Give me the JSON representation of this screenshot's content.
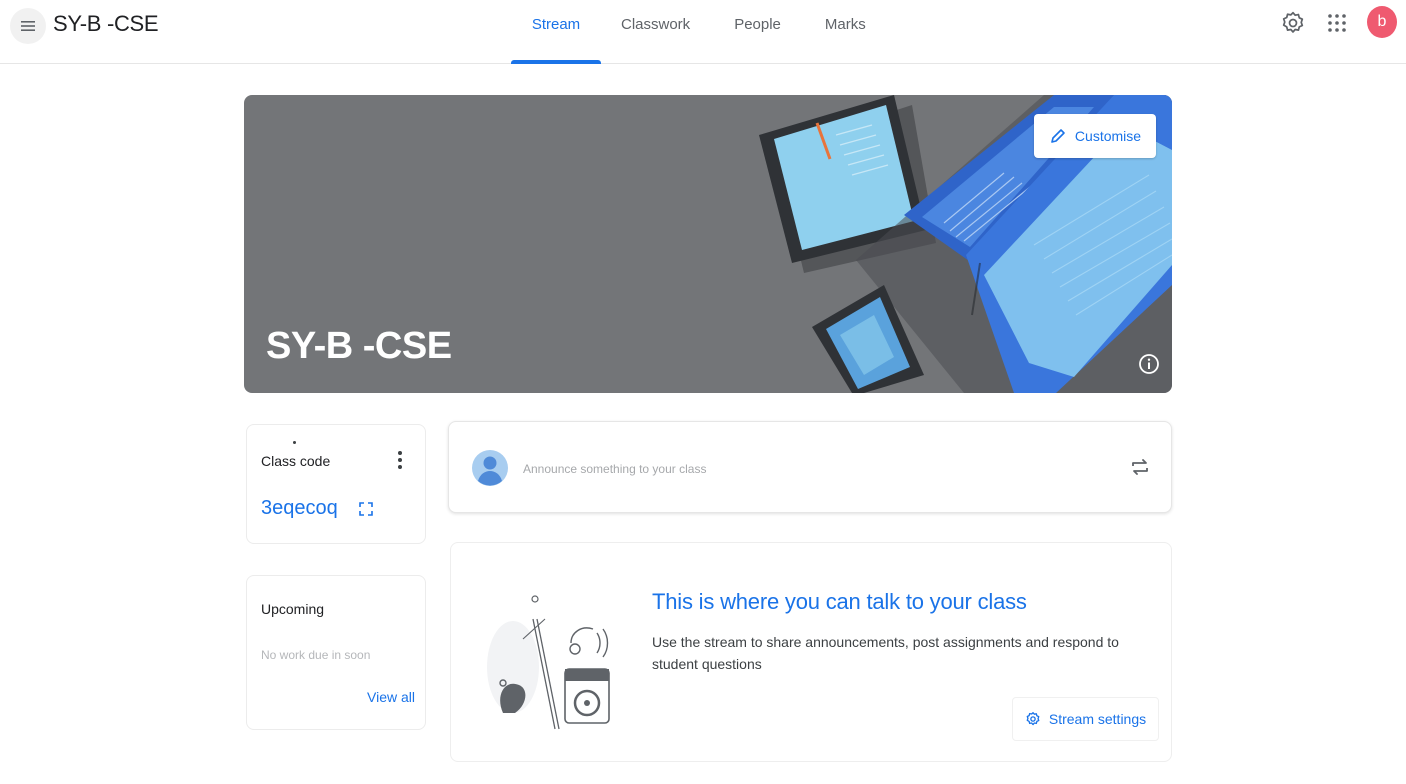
{
  "header": {
    "menu_icon": "hamburger-menu-icon",
    "title": "SY-B -CSE",
    "tabs": [
      {
        "label": "Stream",
        "active": true
      },
      {
        "label": "Classwork",
        "active": false
      },
      {
        "label": "People",
        "active": false
      },
      {
        "label": "Marks",
        "active": false
      }
    ],
    "settings_icon": "gear-icon",
    "apps_icon": "apps-grid-icon",
    "avatar_letter": "b",
    "avatar_color": "#ef5a70"
  },
  "banner": {
    "title": "SY-B -CSE",
    "customise_label": "Customise",
    "customise_icon": "pencil-icon",
    "info_icon": "info-icon"
  },
  "class_code": {
    "label": "Class code",
    "value": "3eqecoq",
    "more_icon": "more-vert-icon",
    "expand_icon": "fullscreen-icon"
  },
  "upcoming": {
    "label": "Upcoming",
    "empty_text": "No work due in soon",
    "view_all_label": "View all"
  },
  "announce": {
    "placeholder": "Announce something to your class",
    "repost_icon": "repost-icon"
  },
  "stream_empty": {
    "heading": "This is where you can talk to your class",
    "description": "Use the stream to share announcements, post assignments and respond to student questions",
    "settings_label": "Stream settings",
    "settings_icon": "gear-icon"
  },
  "colors": {
    "accent": "#1a73e8",
    "banner_bg": "#737578",
    "text": "#3c4043"
  }
}
